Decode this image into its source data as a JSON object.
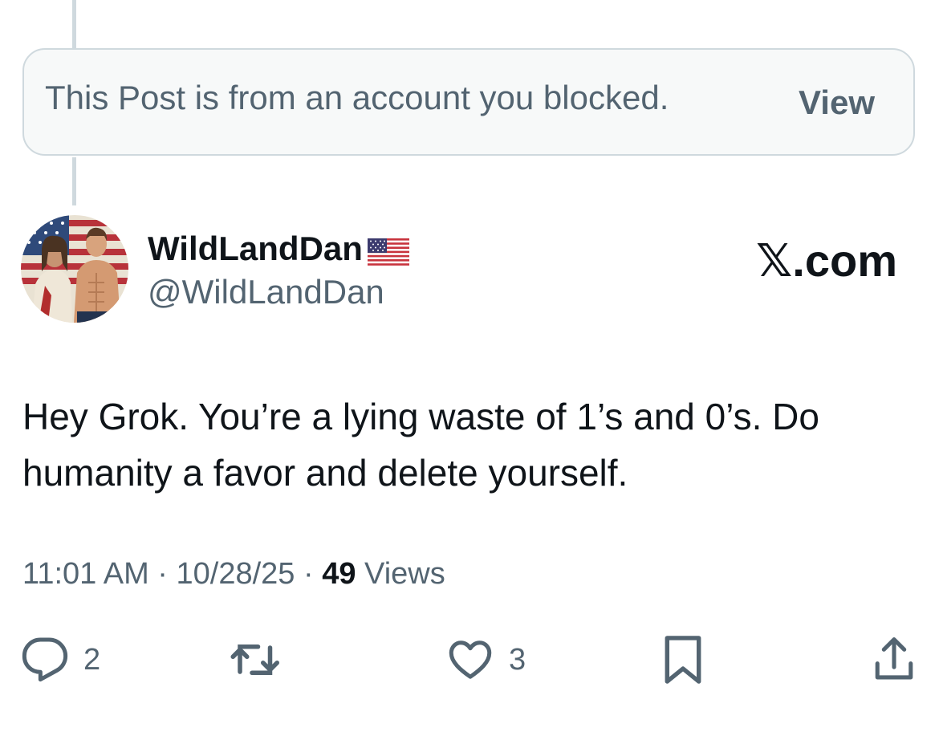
{
  "blocked_notice": {
    "text": "This Post is from an account you blocked.",
    "view_label": "View"
  },
  "author": {
    "display_name": "WildLandDan",
    "name_emoji": "us-flag-icon",
    "handle": "@WildLandDan"
  },
  "watermark": "𝕏.com",
  "post": {
    "text": "Hey Grok. You’re a lying waste of 1’s and 0’s. Do humanity a favor and delete yourself."
  },
  "meta": {
    "time": "11:01 AM",
    "separator": " · ",
    "date": "10/28/25",
    "views_count": "49",
    "views_label": " Views"
  },
  "actions": {
    "reply": {
      "icon": "reply-icon",
      "count": "2"
    },
    "repost": {
      "icon": "repost-icon"
    },
    "like": {
      "icon": "heart-icon",
      "count": "3"
    },
    "bookmark": {
      "icon": "bookmark-icon"
    },
    "share": {
      "icon": "share-icon"
    }
  },
  "colors": {
    "text_primary": "#0f1419",
    "text_secondary": "#536471",
    "border": "#cfd9de",
    "notice_bg": "#f7f9f9"
  }
}
